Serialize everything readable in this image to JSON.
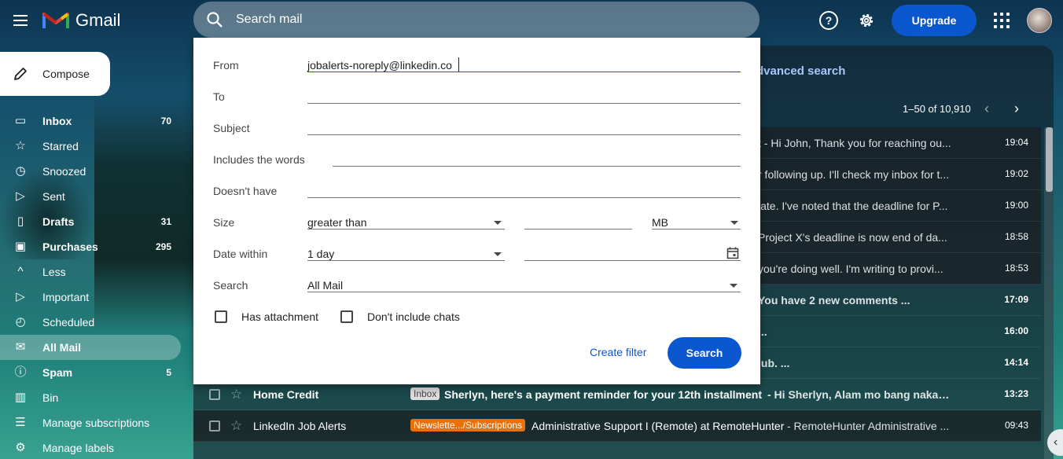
{
  "app": {
    "title": "Gmail"
  },
  "header": {
    "search_placeholder": "Search mail",
    "upgrade_label": "Upgrade",
    "help_glyph": "?"
  },
  "sidebar": {
    "compose_label": "Compose",
    "items": [
      {
        "label": "Inbox",
        "count": "70",
        "icon": "inbox-icon",
        "glyph": "▭",
        "bold": true
      },
      {
        "label": "Starred",
        "count": "",
        "icon": "star-icon",
        "glyph": "☆",
        "bold": false
      },
      {
        "label": "Snoozed",
        "count": "",
        "icon": "clock-icon",
        "glyph": "◷",
        "bold": false
      },
      {
        "label": "Sent",
        "count": "",
        "icon": "send-icon",
        "glyph": "▷",
        "bold": false
      },
      {
        "label": "Drafts",
        "count": "31",
        "icon": "draft-icon",
        "glyph": "▯",
        "bold": true
      },
      {
        "label": "Purchases",
        "count": "295",
        "icon": "shopping-bag-icon",
        "glyph": "▣",
        "bold": true
      },
      {
        "label": "Less",
        "count": "",
        "icon": "chevron-up-icon",
        "glyph": "^",
        "bold": false
      },
      {
        "label": "Important",
        "count": "",
        "icon": "label-important-icon",
        "glyph": "▷",
        "bold": false
      },
      {
        "label": "Scheduled",
        "count": "",
        "icon": "scheduled-send-icon",
        "glyph": "◴",
        "bold": false
      },
      {
        "label": "All Mail",
        "count": "",
        "icon": "all-mail-icon",
        "glyph": "✉",
        "bold": true,
        "active": true
      },
      {
        "label": "Spam",
        "count": "5",
        "icon": "report-icon",
        "glyph": "ⓘ",
        "bold": true
      },
      {
        "label": "Bin",
        "count": "",
        "icon": "trash-icon",
        "glyph": "▥",
        "bold": false
      },
      {
        "label": "Manage subscriptions",
        "count": "",
        "icon": "subscriptions-icon",
        "glyph": "☰",
        "bold": false
      },
      {
        "label": "Manage labels",
        "count": "",
        "icon": "settings-icon",
        "glyph": "⚙",
        "bold": false
      }
    ]
  },
  "toolbar": {
    "advanced_search_fragment": "dvanced search",
    "pager": "1–50 of 10,910"
  },
  "emails": [
    {
      "sender": "",
      "badge": "",
      "subject": "",
      "snippet": "t - Hi John, Thank you for reaching ou...",
      "time": "19:04",
      "dark": true,
      "unread": false
    },
    {
      "sender": "",
      "badge": "",
      "subject": "",
      "snippet": "r following up. I'll check my inbox for t...",
      "time": "19:02",
      "dark": true,
      "unread": false
    },
    {
      "sender": "",
      "badge": "",
      "subject": "",
      "snippet": "late. I've noted that the deadline for P...",
      "time": "19:00",
      "dark": true,
      "unread": false
    },
    {
      "sender": "",
      "badge": "",
      "subject": "",
      "snippet": "Project X's deadline is now end of da...",
      "time": "18:58",
      "dark": true,
      "unread": false
    },
    {
      "sender": "",
      "badge": "",
      "subject": "",
      "snippet": "you're doing well. I'm writing to provi...",
      "time": "18:53",
      "dark": true,
      "unread": false
    },
    {
      "sender": "",
      "badge": "",
      "subject": "",
      "snippet": "You have 2 new comments      ...",
      "time": "17:09",
      "dark": false,
      "unread": true
    },
    {
      "sender": "",
      "badge": "",
      "subject": "",
      "snippet": "...",
      "time": "16:00",
      "dark": false,
      "unread": true
    },
    {
      "sender": "",
      "badge": "",
      "subject": "",
      "snippet": "lub.      ...",
      "time": "14:14",
      "dark": false,
      "unread": true
    },
    {
      "sender": "Home Credit",
      "badge": "Inbox",
      "badge_color": "#dddddd",
      "badge_text_color": "#444444",
      "subject": "Sherlyn, here's a payment reminder for your 12th installment",
      "snippet": " - Hi Sherlyn, Alam mo bang nakaka...",
      "time": "13:23",
      "dark": false,
      "unread": true
    },
    {
      "sender": "LinkedIn Job Alerts",
      "badge": "Newslette.../Subscriptions",
      "badge_color": "#e8710a",
      "badge_text_color": "#ffffff",
      "subject": "Administrative Support I (Remote) at RemoteHunter",
      "snippet": " - RemoteHunter Administrative ...",
      "time": "09:43",
      "dark": true,
      "unread": false
    }
  ],
  "advanced_search": {
    "from_label": "From",
    "from_value": "jobalerts-noreply@linkedin.co",
    "to_label": "To",
    "subject_label": "Subject",
    "includes_label": "Includes the words",
    "doesnt_have_label": "Doesn't have",
    "size_label": "Size",
    "size_comparator": "greater than",
    "size_unit": "MB",
    "date_within_label": "Date within",
    "date_within_value": "1 day",
    "search_label": "Search",
    "search_scope": "All Mail",
    "has_attachment_label": "Has attachment",
    "dont_include_chats_label": "Don't include chats",
    "create_filter_label": "Create filter",
    "search_button_label": "Search"
  },
  "colors": {
    "accent": "#0b57d0",
    "advanced_title": "#a8c7fa"
  }
}
